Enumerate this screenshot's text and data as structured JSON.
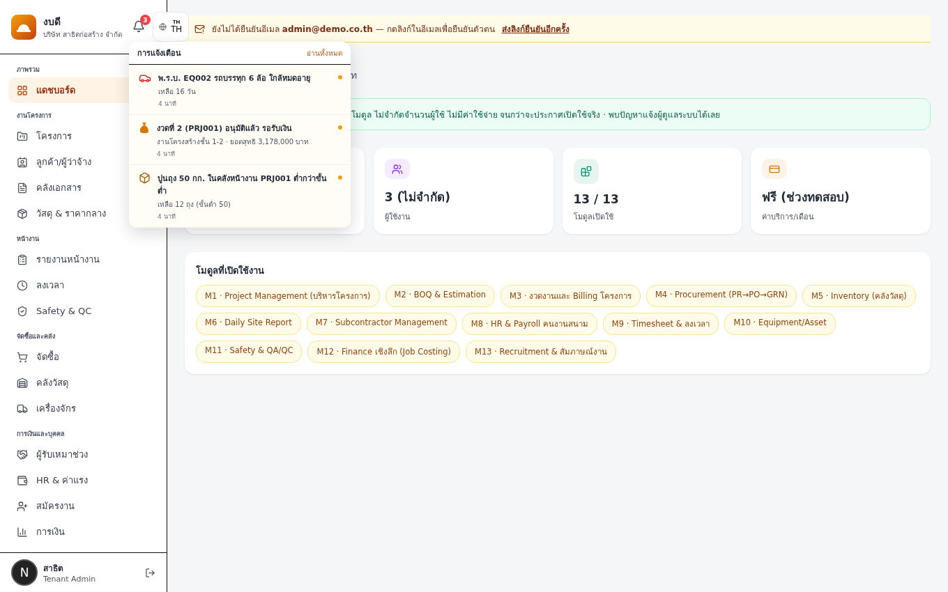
{
  "brand": {
    "name": "งบดี",
    "company": "บริษัท สาธิตก่อสร้าง จำกัด"
  },
  "notifications_button": {
    "count": "3"
  },
  "language": {
    "small": "TH",
    "label": "TH"
  },
  "sidebar": {
    "sections": [
      {
        "title": "ภาพรวม",
        "items": [
          {
            "label": "แดชบอร์ด",
            "selected": true
          }
        ]
      },
      {
        "title": "งานโครงการ",
        "items": [
          {
            "label": "โครงการ",
            "selected": false
          },
          {
            "label": "ลูกค้า/ผู้ว่าจ้าง",
            "selected": false
          },
          {
            "label": "คลังเอกสาร",
            "selected": false
          },
          {
            "label": "วัสดุ & ราคากลาง",
            "selected": false
          }
        ]
      },
      {
        "title": "หน้างาน",
        "items": [
          {
            "label": "รายงานหน้างาน",
            "selected": false
          },
          {
            "label": "ลงเวลา",
            "selected": false
          },
          {
            "label": "Safety & QC",
            "selected": false
          }
        ]
      },
      {
        "title": "จัดซื้อและคลัง",
        "items": [
          {
            "label": "จัดซื้อ",
            "selected": false
          },
          {
            "label": "คลังวัสดุ",
            "selected": false
          },
          {
            "label": "เครื่องจักร",
            "selected": false
          }
        ]
      },
      {
        "title": "การเงินและบุคคล",
        "items": [
          {
            "label": "ผู้รับเหมาช่วง",
            "selected": false
          },
          {
            "label": "HR & ค่าแรง",
            "selected": false
          },
          {
            "label": "สมัครงาน",
            "selected": false
          },
          {
            "label": "การเงิน",
            "selected": false
          }
        ]
      }
    ]
  },
  "user": {
    "name": "สาธิต",
    "role": "Tenant Admin",
    "avatar": "N"
  },
  "email_banner": {
    "text": "ยังไม่ได้ยืนยันอีเมล **admin@demo.co.th** — กดลิงก์ในอีเมลเพื่อยืนยันตัวตน",
    "link": "ส่งลิงก์ยืนยันอีกครั้ง"
  },
  "page_title_fragment": "ท",
  "trial_banner": "โมดูล ไม่จำกัดจำนวนผู้ใช้ ไม่มีค่าใช้จ่าย จนกว่าจะประกาศเปิดใช้จริง · พบปัญหาแจ้งผู้ดูแลระบบได้เลย",
  "stats": [
    {
      "kind": "hidden"
    },
    {
      "kind": "stat",
      "color": "#9333ea",
      "value": "3 (ไม่จำกัด)",
      "label": "ผู้ใช้งาน"
    },
    {
      "kind": "stat",
      "color": "#059669",
      "value": "13 / 13",
      "label": "โมดูลเปิดใช้"
    },
    {
      "kind": "stat",
      "color": "#d97706",
      "value": "ฟรี (ช่วงทดสอบ)",
      "label": "ค่าบริการ/เดือน"
    }
  ],
  "modules": {
    "title": "โมดูลที่เปิดใช้งาน",
    "items": [
      "M1 · Project Management (บริหารโครงการ)",
      "M2 · BOQ & Estimation",
      "M3 · งวดงานและ Billing โครงการ",
      "M4 · Procurement (PR→PO→GRN)",
      "M5 · Inventory (คลังวัสดุ)",
      "M6 · Daily Site Report",
      "M7 · Subcontractor Management",
      "M8 · HR & Payroll คนงานสนาม",
      "M9 · Timesheet & ลงเวลา",
      "M10 · Equipment/Asset",
      "M11 · Safety & QA/QC",
      "M12 · Finance เชิงลึก (Job Costing)",
      "M13 · Recruitment & สัมภาษณ์งาน"
    ]
  },
  "notification_panel": {
    "title": "การแจ้งเตือน",
    "mark_all": "อ่านทั้งหมด",
    "items": [
      {
        "title": "พ.ร.บ. EQ002 รถบรรทุก 6 ล้อ ใกล้หมดอายุ",
        "detail": "เหลือ 16 วัน",
        "time": "4 นาที",
        "unread": true
      },
      {
        "title": "งวดที่ 2 (PRJ001) อนุมัติแล้ว รอรับเงิน",
        "detail": "งานโครงสร้างชั้น 1-2 · ยอดสุทธิ 3,178,000 บาท",
        "time": "4 นาที",
        "unread": true
      },
      {
        "title": "ปูนถุง 50 กก. ในคลังหน้างาน PRJ001 ต่ำกว่าขั้นต่ำ",
        "detail": "เหลือ 12 ถุง (ขั้นต่ำ 50)",
        "time": "4 นาที",
        "unread": true
      }
    ]
  }
}
